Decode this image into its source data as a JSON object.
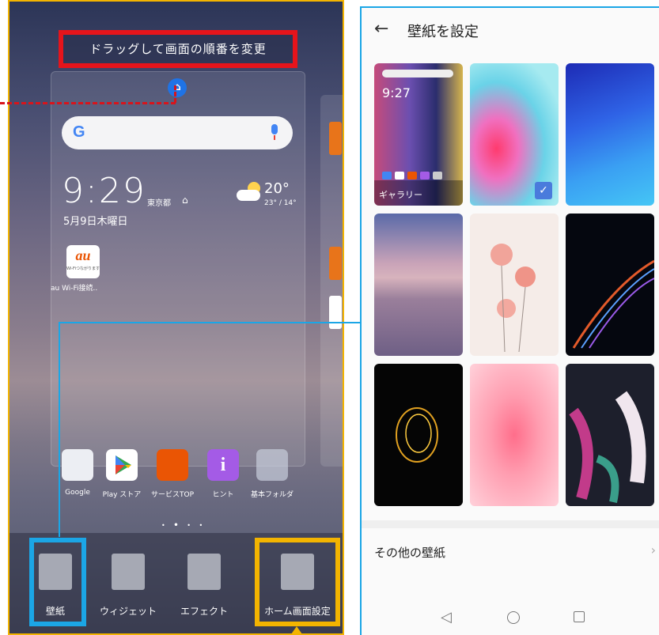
{
  "left": {
    "drag_label": "ドラッグして画面の順番を変更",
    "clock": "9:29",
    "clock_location": "東京都",
    "date": "5月9日木曜日",
    "temperature": "20°",
    "temperature_range": "23° / 14°",
    "search_logo": "G",
    "au_logo": "au",
    "au_sub": "Wi-Fiつながります",
    "au_app_label": "au Wi-Fi接続..",
    "dock_apps": [
      {
        "label": "Google"
      },
      {
        "label": "Play ストア"
      },
      {
        "label": "サービスTOP"
      },
      {
        "label": "ヒント"
      },
      {
        "label": "基本フォルダ"
      }
    ],
    "bottom_items": [
      {
        "label": "壁紙",
        "icon": "wallpaper-icon"
      },
      {
        "label": "ウィジェット",
        "icon": "widget-icon"
      },
      {
        "label": "エフェクト",
        "icon": "effect-icon"
      },
      {
        "label": "ホーム画面設定",
        "icon": "more-vertical-icon"
      }
    ],
    "accents": {
      "red": "#e6141b",
      "blue": "#1ba6e6",
      "yellow": "#f3b400"
    }
  },
  "right": {
    "title": "壁紙を設定",
    "gallery_caption": "ギャラリー",
    "gallery_time": "9:27",
    "more_wallpapers": "その他の壁紙",
    "chevron": "›"
  }
}
